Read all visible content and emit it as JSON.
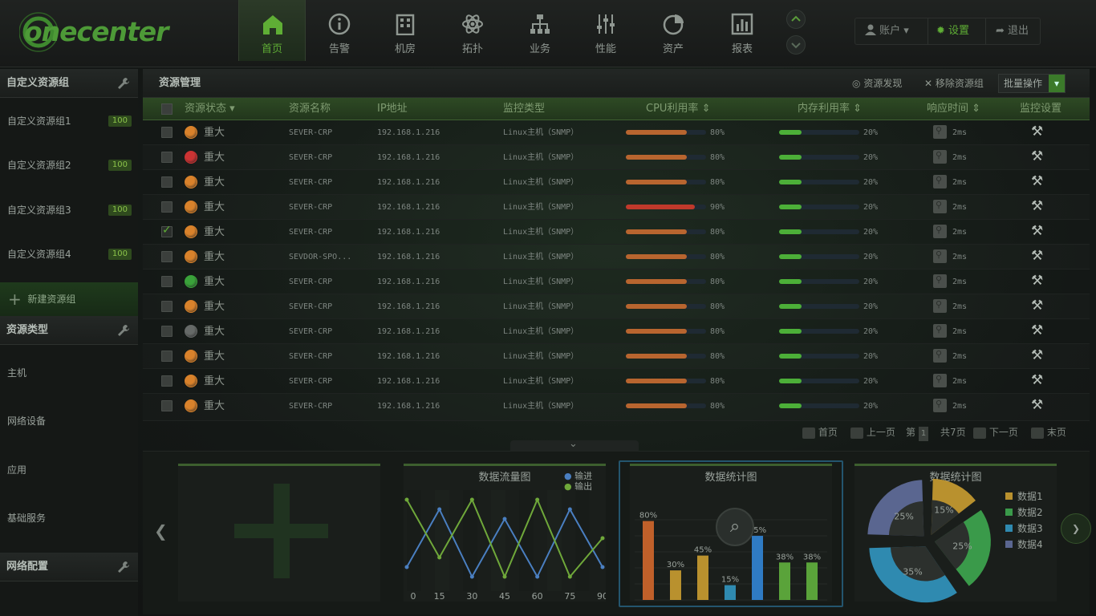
{
  "brand": {
    "logo_text": "onecenter"
  },
  "nav": [
    {
      "id": "home",
      "label": "首页",
      "icon": "home-icon",
      "active": true
    },
    {
      "id": "alarm",
      "label": "告警",
      "icon": "info-icon"
    },
    {
      "id": "room",
      "label": "机房",
      "icon": "building-icon"
    },
    {
      "id": "topo",
      "label": "拓扑",
      "icon": "atom-icon"
    },
    {
      "id": "biz",
      "label": "业务",
      "icon": "org-chart-icon"
    },
    {
      "id": "perf",
      "label": "性能",
      "icon": "sliders-icon"
    },
    {
      "id": "asset",
      "label": "资产",
      "icon": "pie-chart-icon"
    },
    {
      "id": "report",
      "label": "报表",
      "icon": "bar-chart-icon"
    }
  ],
  "account": {
    "account_label": "账户",
    "settings_label": "设置",
    "logout_label": "退出"
  },
  "sidebar": {
    "groups_title": "自定义资源组",
    "groups": [
      {
        "label": "自定义资源组1",
        "count": "100"
      },
      {
        "label": "自定义资源组2",
        "count": "100"
      },
      {
        "label": "自定义资源组3",
        "count": "100"
      },
      {
        "label": "自定义资源组4",
        "count": "100"
      }
    ],
    "new_group_label": "新建资源组",
    "types_title": "资源类型",
    "types": [
      "主机",
      "网络设备",
      "应用",
      "基础服务"
    ],
    "network_title": "网络配置"
  },
  "main": {
    "title": "资源管理",
    "discover_label": "资源发现",
    "remove_label": "移除资源组",
    "batch_label": "批量操作",
    "columns": [
      "资源状态",
      "资源名称",
      "IP地址",
      "监控类型",
      "CPU利用率",
      "内存利用率",
      "响应时间",
      "监控设置"
    ],
    "rows": [
      {
        "checked": false,
        "status_color": "#d9822b",
        "status": "重大",
        "name": "SEVER-CRP",
        "ip": "192.168.1.216",
        "type": "Linux主机（SNMP）",
        "cpu": 80,
        "cpu_label": "80%",
        "mem": 20,
        "mem_label": "20%",
        "resp": "2ms"
      },
      {
        "checked": false,
        "status_color": "#cc3333",
        "status": "重大",
        "name": "SEVER-CRP",
        "ip": "192.168.1.216",
        "type": "Linux主机（SNMP）",
        "cpu": 80,
        "cpu_label": "80%",
        "mem": 20,
        "mem_label": "20%",
        "resp": "2ms"
      },
      {
        "checked": false,
        "status_color": "#d9822b",
        "status": "重大",
        "name": "SEVER-CRP",
        "ip": "192.168.1.216",
        "type": "Linux主机（SNMP）",
        "cpu": 80,
        "cpu_label": "80%",
        "mem": 20,
        "mem_label": "20%",
        "resp": "2ms"
      },
      {
        "checked": false,
        "status_color": "#d9822b",
        "status": "重大",
        "name": "SEVER-CRP",
        "ip": "192.168.1.216",
        "type": "Linux主机（SNMP）",
        "cpu": 90,
        "cpu_label": "90%",
        "mem": 20,
        "mem_label": "20%",
        "resp": "2ms"
      },
      {
        "checked": true,
        "status_color": "#d9822b",
        "status": "重大",
        "name": "SEVER-CRP",
        "ip": "192.168.1.216",
        "type": "Linux主机（SNMP）",
        "cpu": 80,
        "cpu_label": "80%",
        "mem": 20,
        "mem_label": "20%",
        "resp": "2ms"
      },
      {
        "checked": false,
        "status_color": "#d9822b",
        "status": "重大",
        "name": "SEVDOR-SPO...",
        "ip": "192.168.1.216",
        "type": "Linux主机（SNMP）",
        "cpu": 80,
        "cpu_label": "80%",
        "mem": 20,
        "mem_label": "20%",
        "resp": "2ms"
      },
      {
        "checked": false,
        "status_color": "#3aa23a",
        "status": "重大",
        "name": "SEVER-CRP",
        "ip": "192.168.1.216",
        "type": "Linux主机（SNMP）",
        "cpu": 80,
        "cpu_label": "80%",
        "mem": 20,
        "mem_label": "20%",
        "resp": "2ms"
      },
      {
        "checked": false,
        "status_color": "#d9822b",
        "status": "重大",
        "name": "SEVER-CRP",
        "ip": "192.168.1.216",
        "type": "Linux主机（SNMP）",
        "cpu": 80,
        "cpu_label": "80%",
        "mem": 20,
        "mem_label": "20%",
        "resp": "2ms"
      },
      {
        "checked": false,
        "status_color": "#666a68",
        "status": "重大",
        "name": "SEVER-CRP",
        "ip": "192.168.1.216",
        "type": "Linux主机（SNMP）",
        "cpu": 80,
        "cpu_label": "80%",
        "mem": 20,
        "mem_label": "20%",
        "resp": "2ms"
      },
      {
        "checked": false,
        "status_color": "#d9822b",
        "status": "重大",
        "name": "SEVER-CRP",
        "ip": "192.168.1.216",
        "type": "Linux主机（SNMP）",
        "cpu": 80,
        "cpu_label": "80%",
        "mem": 20,
        "mem_label": "20%",
        "resp": "2ms"
      },
      {
        "checked": false,
        "status_color": "#d9822b",
        "status": "重大",
        "name": "SEVER-CRP",
        "ip": "192.168.1.216",
        "type": "Linux主机（SNMP）",
        "cpu": 80,
        "cpu_label": "80%",
        "mem": 20,
        "mem_label": "20%",
        "resp": "2ms"
      },
      {
        "checked": false,
        "status_color": "#d9822b",
        "status": "重大",
        "name": "SEVER-CRP",
        "ip": "192.168.1.216",
        "type": "Linux主机（SNMP）",
        "cpu": 80,
        "cpu_label": "80%",
        "mem": 20,
        "mem_label": "20%",
        "resp": "2ms"
      }
    ]
  },
  "pager": {
    "first": "首页",
    "prev": "上一页",
    "page_prefix": "第",
    "page": "1",
    "total": "共7页",
    "next": "下一页",
    "last": "末页"
  },
  "colors": {
    "accent": "#5fae35",
    "cpu_bar": "#b8652f",
    "cpu_bar_high": "#c0392b",
    "mem_bar": "#4caf38",
    "line_in": "#4a7fc1",
    "line_out": "#6fa83a"
  },
  "chart_data": [
    {
      "type": "line",
      "title": "数据流量图",
      "x": [
        0,
        15,
        30,
        45,
        60,
        75,
        90
      ],
      "series": [
        {
          "name": "输进",
          "color": "#4a7fc1",
          "values": [
            1,
            7,
            0,
            6,
            0,
            7,
            1
          ]
        },
        {
          "name": "输出",
          "color": "#6fa83a",
          "values": [
            8,
            2,
            8,
            0,
            8,
            0,
            4
          ]
        }
      ],
      "x_ticks": [
        "0",
        "15",
        "30",
        "45",
        "60",
        "75",
        "90"
      ],
      "ylim": [
        -1,
        9
      ]
    },
    {
      "type": "bar",
      "title": "数据统计图",
      "values": [
        80,
        30,
        45,
        15,
        65,
        38,
        38
      ],
      "labels": [
        "80%",
        "30%",
        "45%",
        "15%",
        "65%",
        "38%",
        "38%"
      ],
      "colors": [
        "#c0602a",
        "#b9912e",
        "#b9912e",
        "#2f8ab0",
        "#2f7bc4",
        "#5aa33a",
        "#5aa33a"
      ],
      "ylim": [
        0,
        100
      ]
    },
    {
      "type": "pie",
      "title": "数据统计图",
      "slices": [
        {
          "name": "数据1",
          "value": 15,
          "label": "15%",
          "color": "#b9912e"
        },
        {
          "name": "数据2",
          "value": 25,
          "label": "25%",
          "color": "#3a9a4a"
        },
        {
          "name": "数据3",
          "value": 35,
          "label": "35%",
          "color": "#2f8ab0"
        },
        {
          "name": "数据4",
          "value": 25,
          "label": "25%",
          "color": "#5a6690"
        }
      ]
    }
  ]
}
